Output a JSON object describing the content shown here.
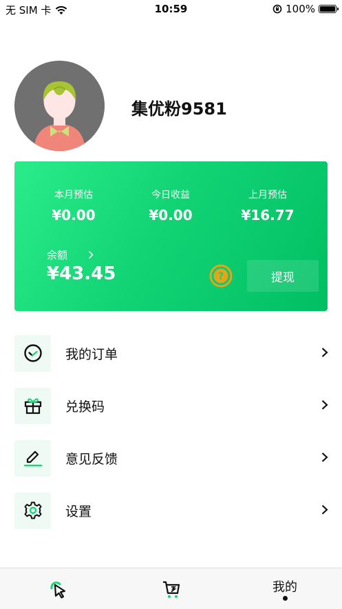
{
  "status_bar": {
    "carrier": "无 SIM 卡",
    "time": "10:59",
    "battery": "100%",
    "icons": [
      "wifi-icon",
      "orientation-lock-icon",
      "battery-icon"
    ]
  },
  "profile": {
    "username": "集优粉9581"
  },
  "earnings": {
    "stats": [
      {
        "label": "本月预估",
        "value": "¥0.00"
      },
      {
        "label": "今日收益",
        "value": "¥0.00"
      },
      {
        "label": "上月预估",
        "value": "¥16.77"
      }
    ],
    "balance_label": "余额",
    "balance_value": "¥43.45",
    "withdraw_label": "提现",
    "help_icon": "question-circle-icon"
  },
  "menu": [
    {
      "label": "我的订单",
      "icon": "clock-icon"
    },
    {
      "label": "兑换码",
      "icon": "gift-icon"
    },
    {
      "label": "意见反馈",
      "icon": "edit-icon"
    },
    {
      "label": "设置",
      "icon": "gear-icon"
    }
  ],
  "tab_bar": {
    "tabs": [
      {
        "icon": "cursor-icon"
      },
      {
        "icon": "cart-icon"
      },
      {
        "label": "我的",
        "active": true
      }
    ]
  },
  "colors": {
    "accent": "#14d778",
    "card_gradient_start": "#2bec8a",
    "card_gradient_end": "#00bf63",
    "help_icon": "#e8a418",
    "menu_icon_bg": "#eefaf3"
  }
}
